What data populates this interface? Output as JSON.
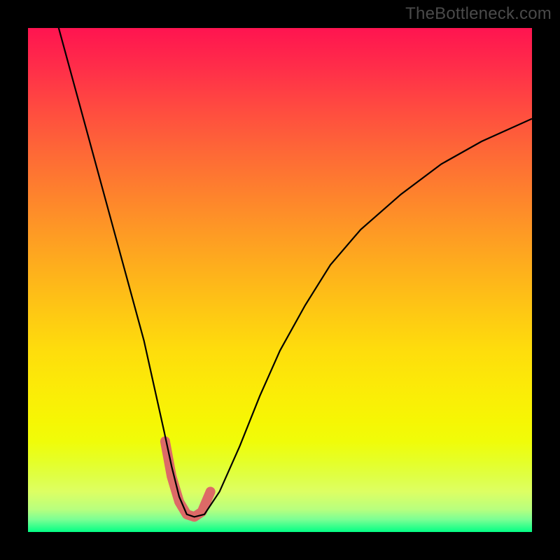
{
  "watermark": "TheBottleneck.com",
  "colors": {
    "background": "#000000",
    "curve": "#000000",
    "highlight": "#dd6a67"
  },
  "chart_data": {
    "type": "line",
    "title": "",
    "xlabel": "",
    "ylabel": "",
    "xlim": [
      0,
      100
    ],
    "ylim": [
      0,
      100
    ],
    "grid": false,
    "legend": false,
    "series": [
      {
        "name": "bottleneck-curve",
        "x": [
          5,
          8,
          11,
          14,
          17,
          20,
          23,
          25,
          27,
          28.5,
          30,
          31.5,
          33,
          35,
          38,
          42,
          46,
          50,
          55,
          60,
          66,
          74,
          82,
          90,
          100
        ],
        "y": [
          104,
          93,
          82,
          71,
          60,
          49,
          38,
          29,
          20,
          13,
          7,
          3.5,
          3,
          3.5,
          8,
          17,
          27,
          36,
          45,
          53,
          60,
          67,
          73,
          77.5,
          82
        ]
      },
      {
        "name": "highlight-segment",
        "x": [
          27.2,
          28.5,
          30,
          31.5,
          33,
          34.5,
          36.2
        ],
        "y": [
          18,
          11,
          6,
          3.5,
          3,
          4,
          8
        ]
      }
    ],
    "gradient_stops": [
      {
        "pos": 0.0,
        "color": "#ff1450"
      },
      {
        "pos": 0.5,
        "color": "#fec714"
      },
      {
        "pos": 0.8,
        "color": "#f0fc09"
      },
      {
        "pos": 1.0,
        "color": "#03ff85"
      }
    ]
  }
}
